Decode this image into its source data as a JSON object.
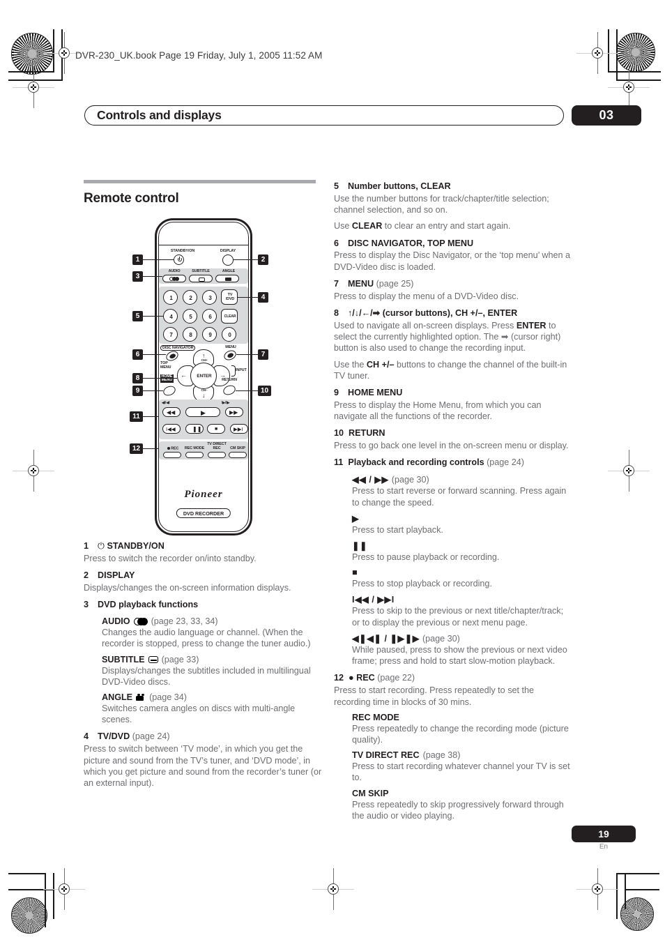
{
  "document": {
    "book_header": "DVR-230_UK.book  Page 19  Friday, July 1, 2005  11:52 AM",
    "chapter_title": "Controls and displays",
    "chapter_number": "03",
    "page_number": "19",
    "page_language": "En"
  },
  "section": {
    "heading": "Remote control"
  },
  "remote_figure": {
    "brand": "Pioneer",
    "model_badge": "DVD RECORDER",
    "callouts": [
      "1",
      "2",
      "3",
      "4",
      "5",
      "6",
      "7",
      "8",
      "9",
      "10",
      "11",
      "12"
    ],
    "labels": {
      "standby": "STANDBY/ON",
      "display": "DISPLAY",
      "audio": "AUDIO",
      "subtitle": "SUBTITLE",
      "angle": "ANGLE",
      "tv_dvd_line1": "TV",
      "tv_dvd_line2": "/DVD",
      "clear": "CLEAR",
      "disc_navigator": "DISC NAVIGATOR",
      "menu": "MENU",
      "top_menu_line1": "TOP",
      "top_menu_line2": "MENU",
      "home_menu_line1": "HOME",
      "home_menu_line2": "MENU",
      "return": "RETURN",
      "input": "INPUT",
      "enter": "ENTER",
      "ch_up": "CH+",
      "ch_down": "CH–",
      "scan_rev_mark": "◀I/◀I",
      "scan_fwd_mark": "I▶/I▶",
      "rec": "REC",
      "rec_mode": "REC MODE",
      "tv_direct_line1": "TV DIRECT",
      "tv_direct_line2": "REC",
      "cm_skip": "CM SKIP"
    },
    "keypad": [
      "1",
      "2",
      "3",
      "4",
      "5",
      "6",
      "7",
      "8",
      "9",
      "0"
    ]
  },
  "entries_left": [
    {
      "num": "1",
      "label": "STANDBY/ON",
      "prefix_glyph": "⏻",
      "body": [
        "Press to switch the recorder on/into standby."
      ]
    },
    {
      "num": "2",
      "label": "DISPLAY",
      "body": [
        "Displays/changes the on-screen information displays."
      ]
    },
    {
      "num": "3",
      "label": "DVD playback functions",
      "sub": [
        {
          "label": "AUDIO",
          "icon": "audio-icon",
          "page": "(page 23, 33, 34)",
          "body": "Changes the audio language or channel. (When the recorder is stopped, press to change the tuner audio.)"
        },
        {
          "label": "SUBTITLE",
          "icon": "subtitle-icon",
          "page": "(page 33)",
          "body": "Displays/changes the subtitles included in multilingual DVD-Video discs."
        },
        {
          "label": "ANGLE",
          "icon": "angle-icon",
          "page": "(page 34)",
          "body": "Switches camera angles on discs with multi-angle scenes."
        }
      ]
    },
    {
      "num": "4",
      "label": "TV/DVD",
      "page": "(page 24)",
      "body": [
        "Press to switch between ‘TV mode’, in which you get the picture and sound from the TV’s tuner, and ‘DVD mode’, in which you get picture and sound from the recorder’s tuner (or an external input)."
      ]
    }
  ],
  "entries_right": [
    {
      "num": "5",
      "label": "Number buttons, CLEAR",
      "body": [
        "Use the number buttons for track/chapter/title selection; channel selection, and so on."
      ],
      "body2_pre": "Use ",
      "body2_bold": "CLEAR",
      "body2_post": " to clear an entry and start again."
    },
    {
      "num": "6",
      "label": "DISC NAVIGATOR, TOP MENU",
      "body": [
        "Press to display the Disc Navigator, or the ‘top menu’ when a DVD-Video disc is loaded."
      ]
    },
    {
      "num": "7",
      "label": "MENU",
      "page": "(page 25)",
      "body": [
        "Press to display the menu of a DVD-Video disc."
      ]
    },
    {
      "num": "8",
      "label": "↑/↓/←/➡ (cursor buttons), CH +/–, ENTER",
      "body_rich_1_a": "Used to navigate all on-screen displays. Press ",
      "body_rich_1_b": "ENTER",
      "body_rich_1_c": " to select the currently highlighted option. The ➡ (cursor right) button is also used to change the recording input.",
      "body_rich_2_a": "Use the ",
      "body_rich_2_b": "CH +/–",
      "body_rich_2_c": " buttons to change the channel of the built-in TV tuner."
    },
    {
      "num": "9",
      "label": "HOME MENU",
      "body": [
        "Press to display the Home Menu, from which you can navigate all the functions of the recorder."
      ]
    },
    {
      "num": "10",
      "label": "RETURN",
      "body": [
        "Press to go back one level in the on-screen menu or display."
      ]
    },
    {
      "num": "11",
      "label": "Playback and recording controls",
      "page": "(page 24)",
      "sub": [
        {
          "glyph": "◀◀  /  ▶▶",
          "page": "(page 30)",
          "body": "Press to start reverse or forward scanning. Press again to change the speed."
        },
        {
          "glyph": "▶",
          "page": "",
          "body": "Press to start playback."
        },
        {
          "glyph": "❚❚",
          "page": "",
          "body": "Press to pause playback or recording."
        },
        {
          "glyph": "■",
          "page": "",
          "body": "Press to stop playback or recording."
        },
        {
          "glyph": "I◀◀  /  ▶▶I",
          "page": "",
          "body": "Press to skip to the previous or next title/chapter/track; or to display the previous or next menu page."
        },
        {
          "glyph": "◀❚◀❚  /  ❚▶❚▶",
          "page": "(page 30)",
          "body": "While paused, press to show the previous or next video frame; press and hold to start slow-motion playback."
        }
      ]
    },
    {
      "num": "12",
      "label": "● REC",
      "page": "(page 22)",
      "body": [
        "Press to start recording. Press repeatedly to set the recording time in blocks of 30 mins."
      ],
      "sub": [
        {
          "glyph": "REC MODE",
          "page": "",
          "body": "Press repeatedly to change the recording mode (picture quality)."
        },
        {
          "glyph": "TV DIRECT REC",
          "page": "(page 38)",
          "body": "Press to start recording whatever channel your TV is set to."
        },
        {
          "glyph": "CM SKIP",
          "page": "",
          "body": "Press repeatedly to skip progressively forward through the audio or video playing."
        }
      ]
    }
  ],
  "colors": {
    "ink": "#231f20",
    "body_gray": "#6d6e71",
    "rule_gray": "#a7a9ac",
    "panel_gray": "#d9dadb"
  }
}
